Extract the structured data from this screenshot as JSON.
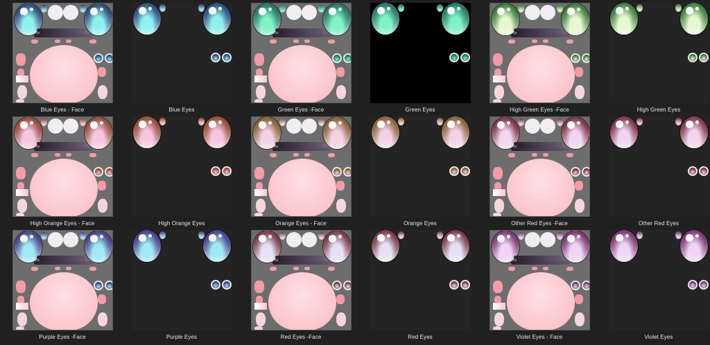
{
  "tiles": [
    {
      "label": "Blue Eyes - Face",
      "kind": "face",
      "c1": "#0d1a5c",
      "c2": "#8ff0f0"
    },
    {
      "label": "Blue Eyes",
      "kind": "eyes",
      "c1": "#0d1a5c",
      "c2": "#8ff0f0"
    },
    {
      "label": "Green Eyes -Face",
      "kind": "face",
      "c1": "#06524a",
      "c2": "#7ff2c6"
    },
    {
      "label": "Green Eyes",
      "kind": "eyes-black",
      "c1": "#06524a",
      "c2": "#7ff2c6"
    },
    {
      "label": "High Green Eyes -Face",
      "kind": "face",
      "c1": "#0a5a12",
      "c2": "#e8f7d0"
    },
    {
      "label": "High Green Eyes",
      "kind": "eyes",
      "c1": "#0a5a12",
      "c2": "#e8f7d0"
    },
    {
      "label": "High Orange  Eyes - Face",
      "kind": "face",
      "c1": "#7a2608",
      "c2": "#f6c6e0"
    },
    {
      "label": "High Orange  Eyes",
      "kind": "eyes",
      "c1": "#7a2608",
      "c2": "#f6c6e0"
    },
    {
      "label": "Orange  Eyes - Face",
      "kind": "face",
      "c1": "#6a4005",
      "c2": "#f3d2e6"
    },
    {
      "label": "Orange  Eyes",
      "kind": "eyes",
      "c1": "#6a4005",
      "c2": "#f3d2e6"
    },
    {
      "label": "Other Red Eyes -Face",
      "kind": "face",
      "c1": "#5c0618",
      "c2": "#f0d6f0"
    },
    {
      "label": "Other Red Eyes",
      "kind": "eyes",
      "c1": "#5c0618",
      "c2": "#f0d6f0"
    },
    {
      "label": "Purple Eyes -Face",
      "kind": "face",
      "c1": "#2a0f6a",
      "c2": "#9fe8f4"
    },
    {
      "label": "Purple Eyes",
      "kind": "eyes",
      "c1": "#2a0f6a",
      "c2": "#9fe8f4"
    },
    {
      "label": "Red Eyes -Face",
      "kind": "face",
      "c1": "#5a0a14",
      "c2": "#e6e0f6"
    },
    {
      "label": "Red Eyes",
      "kind": "eyes",
      "c1": "#5a0a14",
      "c2": "#e6e0f6"
    },
    {
      "label": "Violet Eyes - Face",
      "kind": "face",
      "c1": "#5a0a4a",
      "c2": "#f0d4f4"
    },
    {
      "label": "Violet Eyes",
      "kind": "eyes",
      "c1": "#5a0a4a",
      "c2": "#f0d4f4"
    }
  ]
}
